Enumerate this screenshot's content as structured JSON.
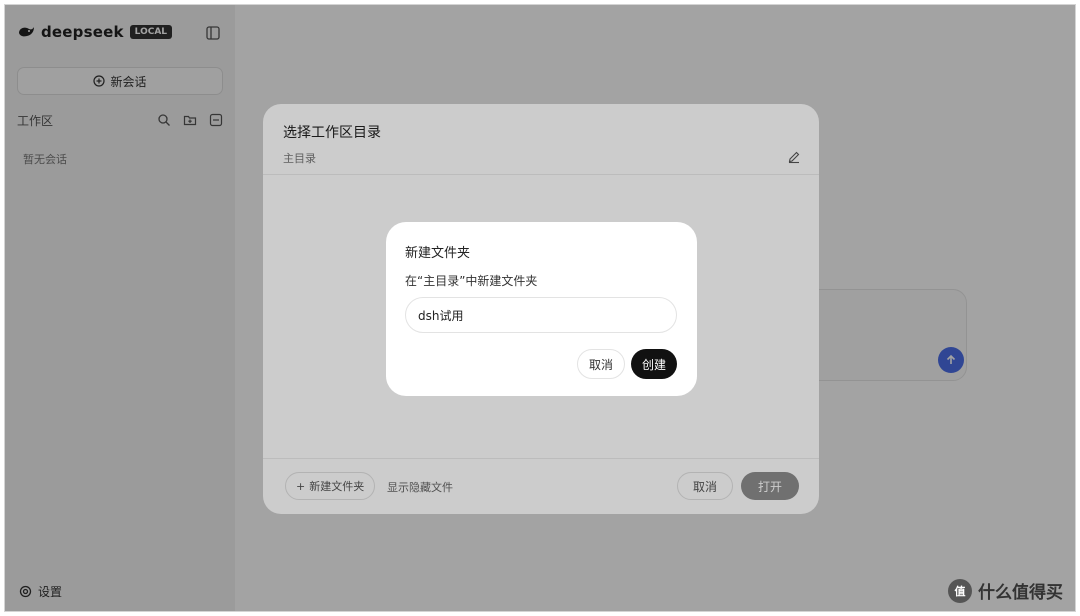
{
  "sidebar": {
    "brand_name": "deepseek",
    "brand_badge": "LOCAL",
    "new_chat_label": "新会话",
    "workspace_title": "工作区",
    "empty_text": "暂无会话",
    "settings_label": "设置"
  },
  "workspace_dialog": {
    "title": "选择工作区目录",
    "path": "主目录",
    "new_folder_label": "新建文件夹",
    "show_hidden_label": "显示隐藏文件",
    "cancel_label": "取消",
    "open_label": "打开"
  },
  "new_folder_dialog": {
    "title": "新建文件夹",
    "description": "在“主目录”中新建文件夹",
    "input_value": "dsh试用",
    "cancel_label": "取消",
    "create_label": "创建"
  },
  "watermark": {
    "text": "什么值得买"
  },
  "colors": {
    "accent": "#4c6fe8",
    "primary_button": "#111111",
    "overlay": "rgba(0,0,0,0.2)"
  }
}
